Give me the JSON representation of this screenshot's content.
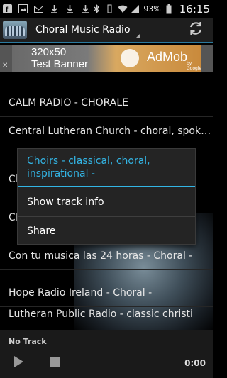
{
  "status_bar": {
    "icons": [
      "facebook-icon",
      "image-icon",
      "gmail-icon",
      "download-icon",
      "download-icon",
      "download-icon",
      "bluetooth-icon",
      "vibrate-icon",
      "wifi-icon",
      "signal-icon",
      "battery-icon"
    ],
    "battery": "93%",
    "time": "16:15"
  },
  "action_bar": {
    "title": "Choral Music Radio",
    "refresh_icon": "refresh-icon"
  },
  "ad": {
    "line1": "320x50",
    "line2": "Test Banner",
    "brand": "AdMob",
    "by": "by Google",
    "close": "✕"
  },
  "stations": [
    "CALM RADIO - CHORALE",
    "Central Lutheran Church - choral, spok…",
    "Ch",
    "Ch",
    "Con tu musica las 24 horas - Choral -",
    "Hope Radio Ireland - Choral -",
    "Lutheran Public Radio - classic christi"
  ],
  "popup": {
    "title": "Choirs - classical, choral, inspirational -",
    "items": [
      "Show track info",
      "Share"
    ]
  },
  "player": {
    "now_playing": "No Track",
    "elapsed": "0:00"
  }
}
